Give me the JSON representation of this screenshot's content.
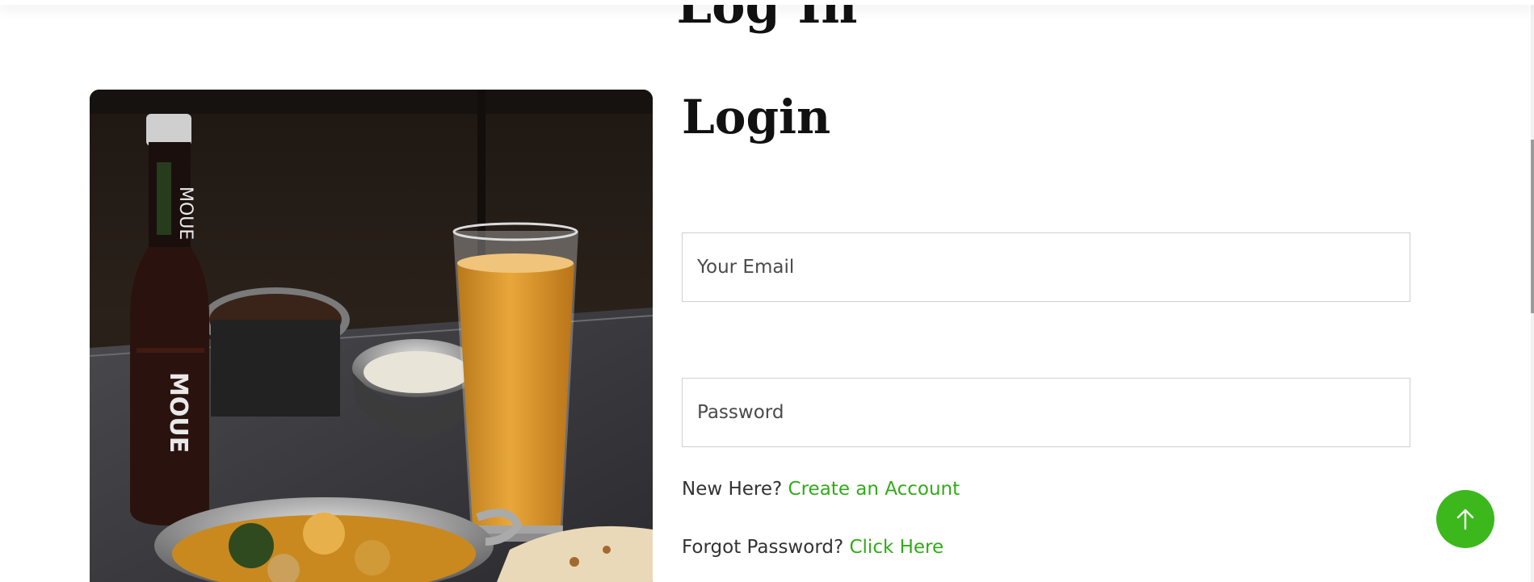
{
  "page": {
    "heading": "Log In"
  },
  "login": {
    "title": "Login",
    "email_placeholder": "Your Email",
    "password_placeholder": "Password",
    "new_here_text": "New Here?",
    "create_account_link": "Create an Account",
    "forgot_text": "Forgot Password?",
    "click_here_link": "Click Here"
  },
  "hero_image": {
    "alt": "Restaurant table with a beer bottle, a glass of juice, curry bowl and rice"
  },
  "colors": {
    "accent": "#3cb81d",
    "link": "#33aa1a",
    "text": "#111111"
  },
  "icons": {
    "scroll_top": "arrow-up-icon"
  }
}
